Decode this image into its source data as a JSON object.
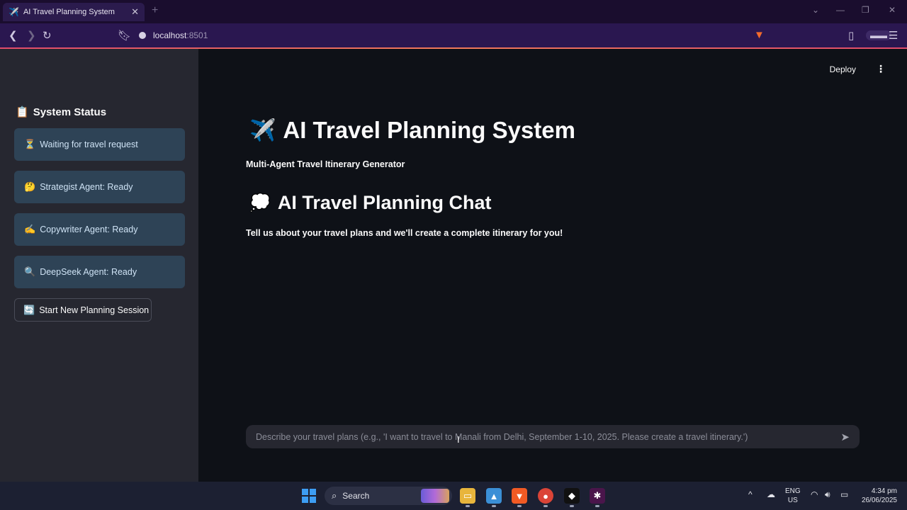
{
  "browser": {
    "tab_title": "AI Travel Planning System",
    "tab_icon": "✈️",
    "url_host": "localhost",
    "url_port": ":8501"
  },
  "app": {
    "deploy_label": "Deploy",
    "title": "AI Travel Planning System",
    "title_emoji": "✈️",
    "subtitle": "Multi-Agent Travel Itinerary Generator",
    "chat_heading": "AI Travel Planning Chat",
    "chat_emoji": "💭",
    "chat_intro": "Tell us about your travel plans and we'll create a complete itinerary for you!",
    "chat_placeholder": "Describe your travel plans (e.g., 'I want to travel to Manali from Delhi, September 1-10, 2025. Please create a travel itinerary.')"
  },
  "sidebar": {
    "title": "System Status",
    "title_emoji": "📋",
    "statuses": [
      {
        "emoji": "⏳",
        "label": "Waiting for travel request"
      },
      {
        "emoji": "🤔",
        "label": "Strategist Agent: Ready"
      },
      {
        "emoji": "✍️",
        "label": "Copywriter Agent: Ready"
      },
      {
        "emoji": "🔍",
        "label": "DeepSeek Agent: Ready"
      }
    ],
    "new_session_emoji": "🔄",
    "new_session_label": "Start New Planning Session"
  },
  "taskbar": {
    "search_label": "Search",
    "lang_line1": "ENG",
    "lang_line2": "US",
    "time": "4:34 pm",
    "date": "26/06/2025"
  },
  "colors": {
    "accent": "#ff4b4b",
    "status_bg": "#2e4356",
    "sidebar_bg": "#262730",
    "main_bg": "#0e1117"
  }
}
